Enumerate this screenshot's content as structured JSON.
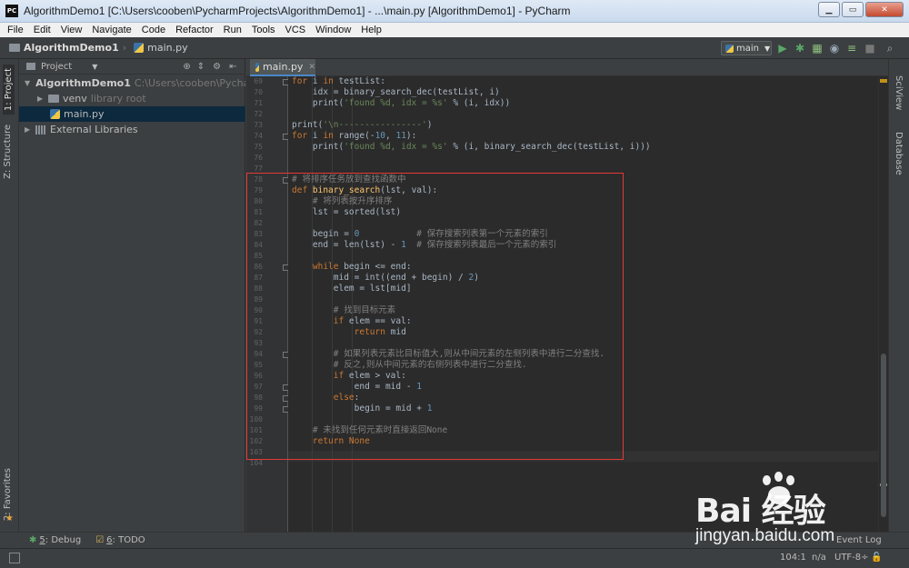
{
  "window": {
    "title": "AlgorithmDemo1 [C:\\Users\\cooben\\PycharmProjects\\AlgorithmDemo1] - ...\\main.py [AlgorithmDemo1] - PyCharm",
    "logo": "PC"
  },
  "menu": [
    "File",
    "Edit",
    "View",
    "Navigate",
    "Code",
    "Refactor",
    "Run",
    "Tools",
    "VCS",
    "Window",
    "Help"
  ],
  "navbar": {
    "project": "AlgorithmDemo1",
    "file": "main.py",
    "run_config": "main"
  },
  "left_stripe": {
    "project_tab": "1: Project",
    "structure_tab": "Z: Structure",
    "favorites_tab": "2: Favorites"
  },
  "right_stripe": {
    "sciview": "SciView",
    "database": "Database"
  },
  "project_panel": {
    "header": "Project",
    "tree": {
      "root_name": "AlgorithmDemo1",
      "root_path": "C:\\Users\\cooben\\PycharmPr",
      "venv_name": "venv",
      "venv_note": "library root",
      "file": "main.py",
      "external": "External Libraries"
    }
  },
  "editor": {
    "tab": "main.py",
    "line_numbers": [
      "69",
      "70",
      "71",
      "72",
      "73",
      "74",
      "75",
      "76",
      "77",
      "78",
      "79",
      "80",
      "81",
      "82",
      "83",
      "84",
      "85",
      "86",
      "87",
      "88",
      "89",
      "90",
      "91",
      "92",
      "93",
      "94",
      "95",
      "96",
      "97",
      "98",
      "99",
      "100",
      "101",
      "102",
      "103",
      "104"
    ],
    "code": {
      "l69a": "for",
      "l69b": " i ",
      "l69c": "in",
      "l69d": " testList:",
      "l70": "    idx = binary_search_dec(testList, i)",
      "l71a": "    print(",
      "l71b": "'found %d, idx = %s'",
      "l71c": " % (i, idx))",
      "l73a": "print(",
      "l73b": "'\\n----------------'",
      "l73c": ")",
      "l74a": "for",
      "l74b": " i ",
      "l74c": "in",
      "l74d": " range(-",
      "l74e": "10",
      "l74f": ", ",
      "l74g": "11",
      "l74h": "):",
      "l75a": "    print(",
      "l75b": "'found %d, idx = %s'",
      "l75c": " % (i, binary_search_dec(testList, i)))",
      "l78": "# 将排序任务放到查找函数中",
      "l79a": "def",
      "l79b": " binary_search",
      "l79c": "(lst, val):",
      "l80": "    # 将列表按升序排序",
      "l81": "    lst = sorted(lst)",
      "l83a": "    begin = ",
      "l83b": "0",
      "l83c": "           # 保存搜索列表第一个元素的索引",
      "l84a": "    end = len(lst) - ",
      "l84b": "1",
      "l84c": "  # 保存搜索列表最后一个元素的索引",
      "l86a": "    while",
      "l86b": " begin <= end:",
      "l87a": "        mid = int((end + begin) / ",
      "l87b": "2",
      "l87c": ")",
      "l88": "        elem = lst[mid]",
      "l90": "        # 找到目标元素",
      "l91a": "        if",
      "l91b": " elem == val:",
      "l92a": "            return",
      "l92b": " mid",
      "l94": "        # 如果列表元素比目标值大,则从中间元素的左侧列表中进行二分查找.",
      "l95": "        # 反之,则从中间元素的右侧列表中进行二分查找.",
      "l96a": "        if",
      "l96b": " elem > val:",
      "l97a": "            end = mid - ",
      "l97b": "1",
      "l98a": "        else",
      "l98b": ":",
      "l99a": "            begin = mid + ",
      "l99b": "1",
      "l101": "    # 未找到任何元素时直接返回None",
      "l102a": "    return",
      "l102b": " None"
    }
  },
  "bottom_tabs": {
    "debug_num": "5",
    "debug": ": Debug",
    "todo_num": "6",
    "todo": ": TODO",
    "event_log": "Event Log"
  },
  "status": {
    "position": "104:1",
    "separator": "n/a",
    "encoding": "UTF-8÷"
  },
  "watermark": {
    "brand": "Bai  经验",
    "url": "jingyan.baidu.com"
  },
  "colors": {
    "keyword": "#cc7832",
    "string": "#6a8759",
    "number": "#6897bb",
    "comment": "#808080",
    "function": "#ffc66d",
    "highlight_box": "#e53935"
  }
}
